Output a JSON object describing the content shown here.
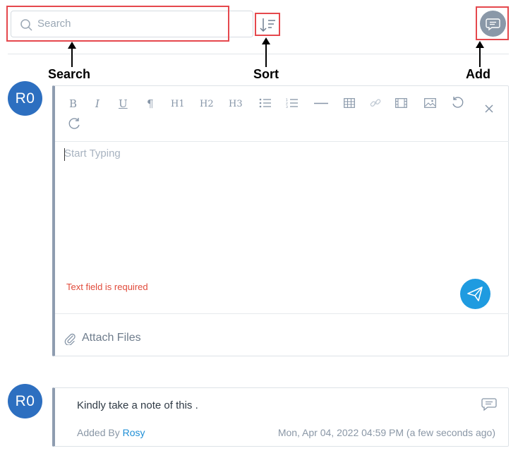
{
  "toolbar": {
    "search_placeholder": "Search"
  },
  "annotations": {
    "search": "Search",
    "sort": "Sort",
    "add": "Add"
  },
  "editor": {
    "avatar_initials": "R0",
    "buttons": [
      "B",
      "I",
      "U",
      "¶",
      "H1",
      "H2",
      "H3"
    ],
    "placeholder": "Start Typing",
    "error": "Text field is required",
    "attach_label": "Attach Files"
  },
  "note": {
    "avatar_initials": "R0",
    "text": "Kindly take a note of this .",
    "added_by_label": "Added By",
    "added_by_name": "Rosy",
    "timestamp": "Mon, Apr 04, 2022 04:59 PM (a few seconds ago)"
  },
  "colors": {
    "highlight": "#e5484d",
    "avatar": "#2d6fc0",
    "send_button": "#1f9be0",
    "error": "#e14b3b",
    "link": "#1f8fd6"
  },
  "icons": [
    "search-icon",
    "sort-icon",
    "comment-icon",
    "bullet-list-icon",
    "numbered-list-icon",
    "horizontal-rule-icon",
    "table-icon",
    "link-icon",
    "video-icon",
    "image-icon",
    "undo-icon",
    "redo-icon",
    "close-icon",
    "send-icon",
    "paperclip-icon"
  ]
}
